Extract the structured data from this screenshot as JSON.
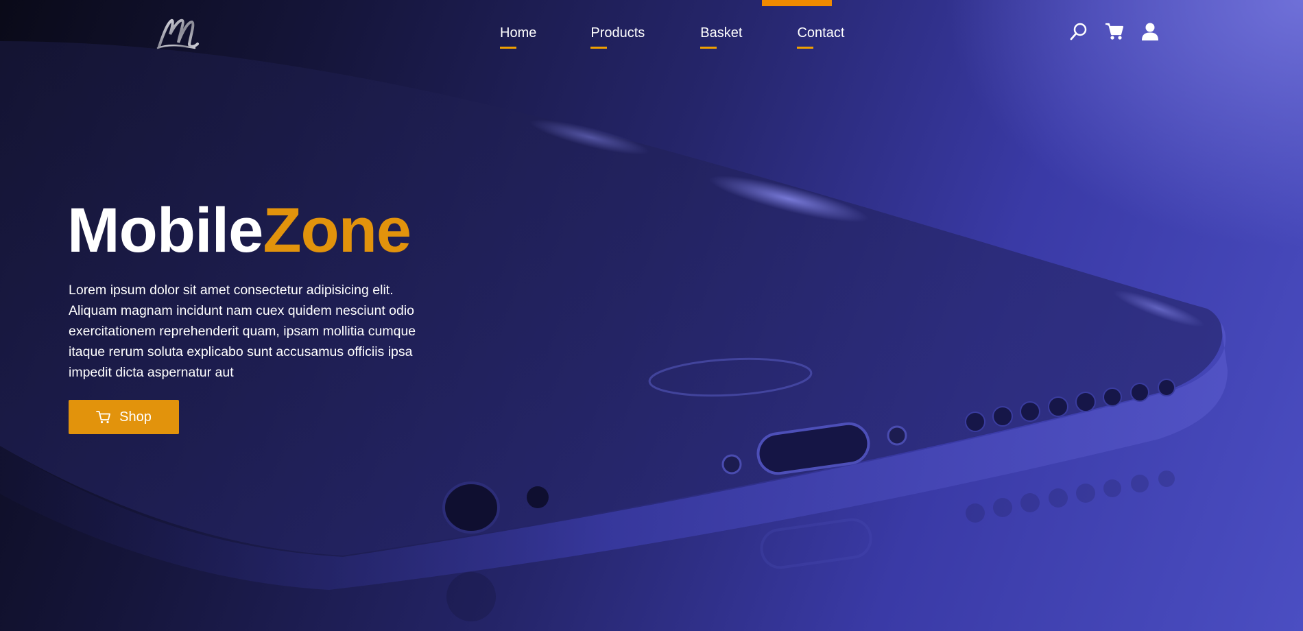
{
  "brand": {
    "logo_icon": "script-m-logo-icon",
    "title_white": "Mobile",
    "title_accent": "Zone",
    "accent_color": "#e2930c"
  },
  "nav": {
    "active_marker_color": "#f08a00",
    "items": [
      {
        "label": "Home"
      },
      {
        "label": "Products"
      },
      {
        "label": "Basket"
      },
      {
        "label": "Contact"
      }
    ]
  },
  "header_icons": [
    "search-icon",
    "cart-icon",
    "user-icon"
  ],
  "hero": {
    "description": "Lorem ipsum dolor sit amet consectetur adipisicing elit. Aliquam magnam incidunt nam cuex quidem nesciunt odio exercitationem reprehenderit quam, ipsam mollitia cumque itaque rerum soluta explicabo sunt accusamus officiis ipsa impedit dicta aspernatur aut",
    "cta_label": "Shop",
    "cta_icon": "cart-outline-icon"
  }
}
